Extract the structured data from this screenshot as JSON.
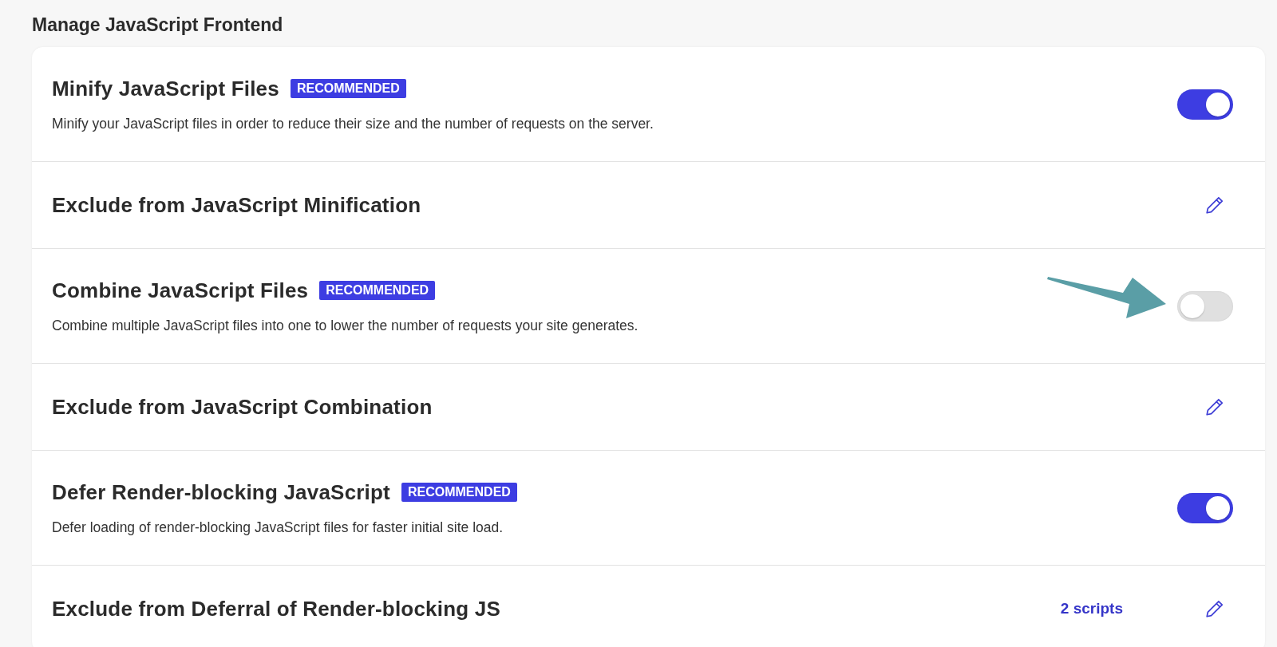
{
  "section_title": "Manage JavaScript Frontend",
  "rows": [
    {
      "kind": "toggle",
      "title": "Minify JavaScript Files",
      "badge": "RECOMMENDED",
      "description": "Minify your JavaScript files in order to reduce their size and the number of requests on the server.",
      "on": true
    },
    {
      "kind": "edit",
      "title": "Exclude from JavaScript Minification"
    },
    {
      "kind": "toggle",
      "title": "Combine JavaScript Files",
      "badge": "RECOMMENDED",
      "description": "Combine multiple JavaScript files into one to lower the number of requests your site generates.",
      "on": false,
      "pointer": true
    },
    {
      "kind": "edit",
      "title": "Exclude from JavaScript Combination"
    },
    {
      "kind": "toggle",
      "title": "Defer Render-blocking JavaScript",
      "badge": "RECOMMENDED",
      "description": "Defer loading of render-blocking JavaScript files for faster initial site load.",
      "on": true
    },
    {
      "kind": "edit",
      "title": "Exclude from Deferral of Render-blocking JS",
      "count": "2 scripts"
    }
  ]
}
